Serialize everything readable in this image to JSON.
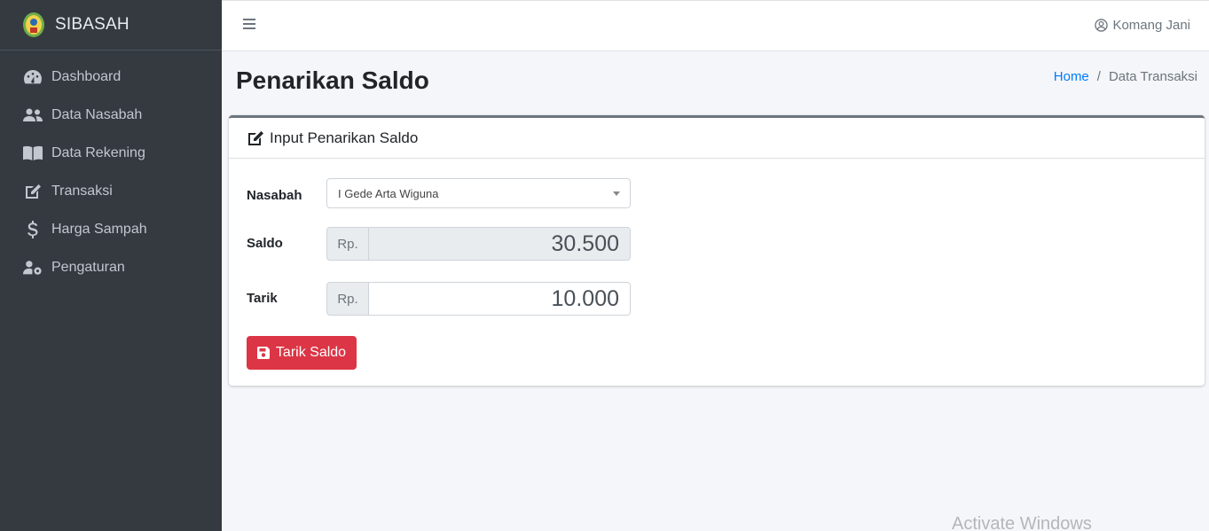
{
  "brand": {
    "name": "SIBASAH"
  },
  "sidebar": {
    "items": [
      {
        "label": "Dashboard",
        "icon": "tachometer-icon"
      },
      {
        "label": "Data Nasabah",
        "icon": "users-icon"
      },
      {
        "label": "Data Rekening",
        "icon": "book-icon"
      },
      {
        "label": "Transaksi",
        "icon": "edit-icon"
      },
      {
        "label": "Harga Sampah",
        "icon": "dollar-icon"
      },
      {
        "label": "Pengaturan",
        "icon": "user-cog-icon"
      }
    ]
  },
  "topbar": {
    "user_name": "Komang Jani"
  },
  "header": {
    "title": "Penarikan Saldo",
    "breadcrumb": {
      "home": "Home",
      "current": "Data Transaksi"
    }
  },
  "card": {
    "title": "Input Penarikan Saldo",
    "form": {
      "nasabah_label": "Nasabah",
      "nasabah_value": "I Gede Arta Wiguna",
      "saldo_label": "Saldo",
      "saldo_prefix": "Rp.",
      "saldo_value": "30.500",
      "tarik_label": "Tarik",
      "tarik_prefix": "Rp.",
      "tarik_value": "10.000"
    },
    "submit_label": "Tarik Saldo"
  },
  "watermark": "Activate Windows",
  "colors": {
    "sidebar": "#343a40",
    "danger": "#dc3545",
    "link": "#007bff"
  }
}
